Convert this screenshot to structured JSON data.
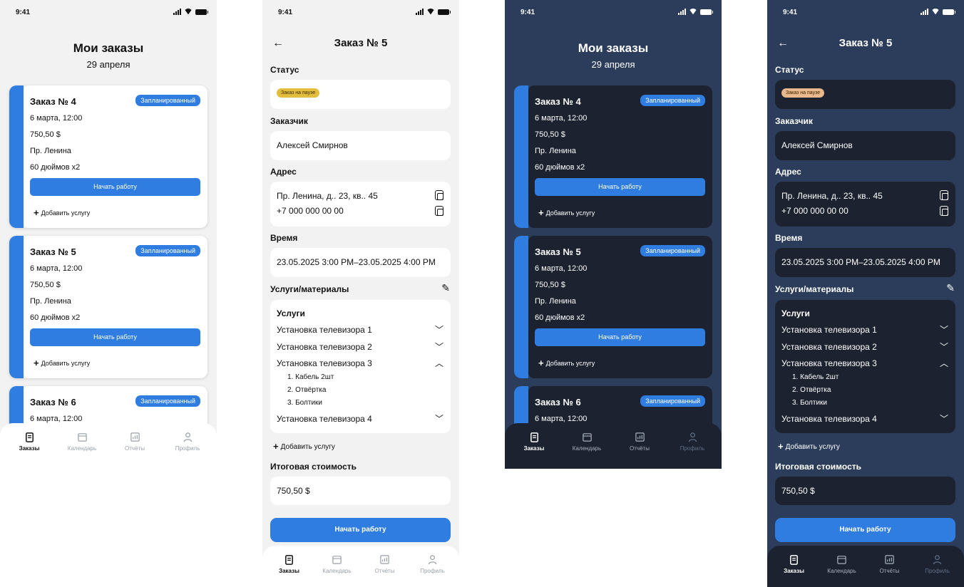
{
  "status_time": "9:41",
  "accent_color": "#2f7de1",
  "list": {
    "title": "Мои заказы",
    "date": "29 апреля",
    "orders": [
      {
        "title": "Заказ № 4",
        "badge": "Запланированный",
        "datetime": "6 марта, 12:00",
        "price": "750,50 $",
        "address": "Пр. Ленина",
        "item": "60 дюймов x2",
        "start_label": "Начать работу",
        "add_label": "Добавить услугу"
      },
      {
        "title": "Заказ № 5",
        "badge": "Запланированный",
        "datetime": "6 марта, 12:00",
        "price": "750,50 $",
        "address": "Пр. Ленина",
        "item": "60 дюймов x2",
        "start_label": "Начать работу",
        "add_label": "Добавить услугу"
      },
      {
        "title": "Заказ № 6",
        "badge": "Запланированный",
        "datetime": "6 марта, 12:00"
      }
    ]
  },
  "tabs": [
    {
      "label": "Заказы",
      "icon": "orders-icon"
    },
    {
      "label": "Календарь",
      "icon": "calendar-icon"
    },
    {
      "label": "Отчёты",
      "icon": "reports-icon"
    },
    {
      "label": "Профиль",
      "icon": "profile-icon"
    }
  ],
  "detail": {
    "title": "Заказ № 5",
    "status_label": "Статус",
    "status_value": "Заказ на паузе",
    "customer_label": "Заказчик",
    "customer_value": "Алексей Смирнов",
    "address_label": "Адрес",
    "address_value": "Пр. Ленина, д.. 23, кв.. 45",
    "phone_value": "+7 000 000 00 00",
    "time_label": "Время",
    "time_value": "23.05.2025 3:00 PM–23.05.2025 4:00 PM",
    "services_label": "Услуги/материалы",
    "services_heading": "Услуги",
    "services": [
      "Установка телевизора 1",
      "Установка телевизора 2",
      "Установка телевизора 3",
      "Установка телевизора 4"
    ],
    "materials": [
      "1.  Кабель 2шт",
      "2.  Отвёртка",
      "3.  Болтики"
    ],
    "add_service": "Добавить услугу",
    "total_label": "Итоговая стоимость",
    "total_value": "750,50 $",
    "start_button": "Начать работу"
  }
}
